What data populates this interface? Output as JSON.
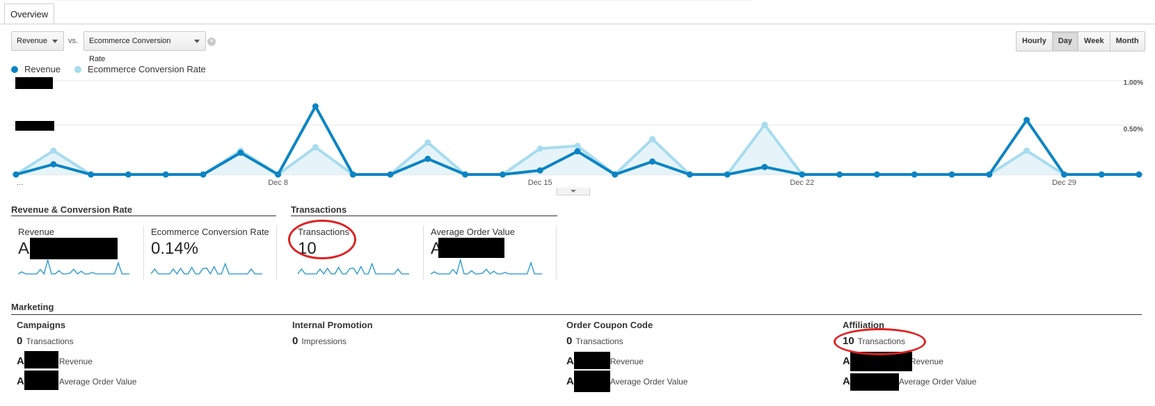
{
  "tab": {
    "label": "Overview"
  },
  "selectors": {
    "metric1": "Revenue",
    "vs_label": "vs.",
    "metric2": "Ecommerce Conversion Rate"
  },
  "time_buttons": [
    "Hourly",
    "Day",
    "Week",
    "Month"
  ],
  "time_active": "Day",
  "legend": [
    {
      "label": "Revenue",
      "color": "#0b84c3"
    },
    {
      "label": "Ecommerce Conversion Rate",
      "color": "#a7dcef"
    }
  ],
  "chart_data": {
    "type": "line",
    "x_tick_labels": [
      "...",
      "Dec 8",
      "Dec 15",
      "Dec 22",
      "Dec 29"
    ],
    "right_axis_labels": [
      "1.00%",
      "0.50%"
    ],
    "left_axis_labels_redacted": true,
    "series": [
      {
        "name": "Revenue",
        "color": "#0b84c3",
        "values": [
          0,
          0.15,
          0,
          0,
          0,
          0,
          0.32,
          0,
          1.0,
          0,
          0,
          0.23,
          0,
          0,
          0.06,
          0.34,
          0,
          0.19,
          0,
          0,
          0.11,
          0,
          0,
          0,
          0,
          0,
          0,
          0.8,
          0,
          0,
          0
        ]
      },
      {
        "name": "Ecommerce Conversion Rate",
        "color": "#a7dcef",
        "values": [
          0,
          0.35,
          0,
          0,
          0,
          0,
          0.35,
          0,
          0.4,
          0,
          0,
          0.47,
          0,
          0,
          0.38,
          0.42,
          0,
          0.52,
          0,
          0,
          0.73,
          0,
          0,
          0,
          0,
          0,
          0,
          0.35,
          0,
          0,
          0
        ]
      }
    ]
  },
  "scorecards": {
    "group1_title": "Revenue & Conversion Rate",
    "group2_title": "Transactions",
    "cards": [
      {
        "label": "Revenue",
        "value": "A",
        "redacted": true
      },
      {
        "label": "Ecommerce Conversion Rate",
        "value": "0.14%"
      },
      {
        "label": "Transactions",
        "value": "10"
      },
      {
        "label": "Average Order Value",
        "value": "A",
        "redacted": true
      }
    ]
  },
  "marketing": {
    "title": "Marketing",
    "columns": [
      {
        "title": "Campaigns",
        "count": "0",
        "count_label": "Transactions",
        "rev_prefix": "A",
        "rev_label": "Revenue",
        "aov_prefix": "A",
        "aov_label": "Average Order Value"
      },
      {
        "title": "Internal Promotion",
        "count": "0",
        "count_label": "Impressions"
      },
      {
        "title": "Order Coupon Code",
        "count": "0",
        "count_label": "Transactions",
        "rev_prefix": "A",
        "rev_label": "Revenue",
        "aov_prefix": "A",
        "aov_label": "Average Order Value"
      },
      {
        "title": "Affiliation",
        "count": "10",
        "count_label": "Transactions",
        "rev_prefix": "A",
        "rev_label": "Revenue",
        "aov_prefix": "A",
        "aov_label": "Average Order Value"
      }
    ]
  }
}
